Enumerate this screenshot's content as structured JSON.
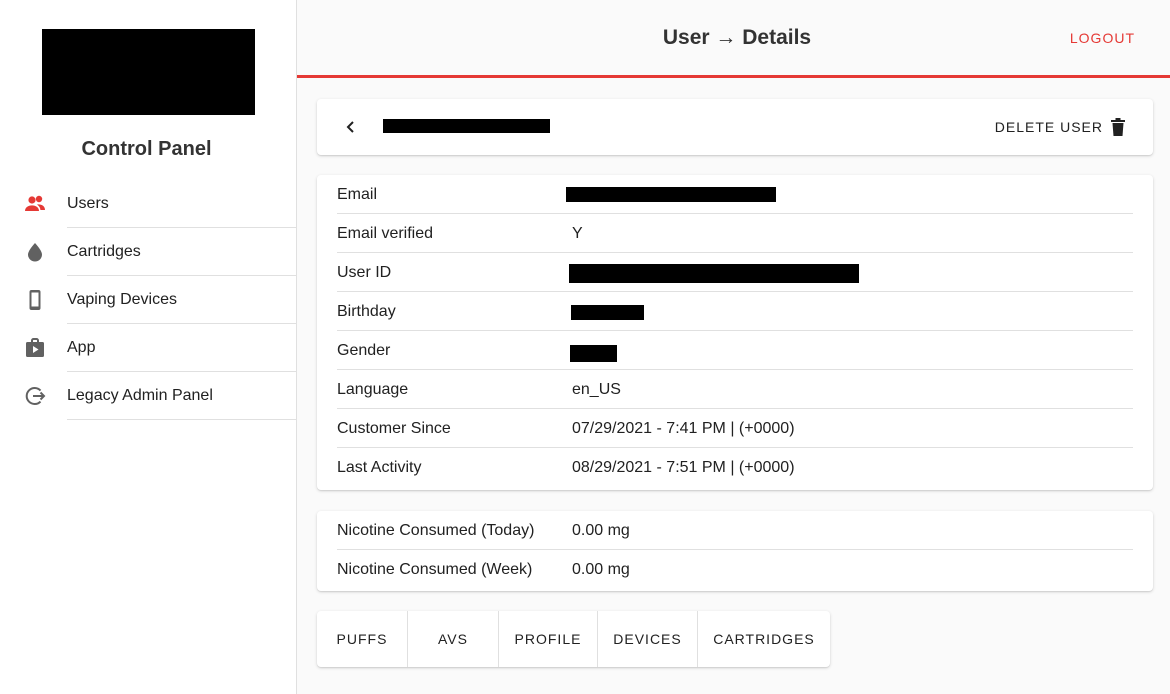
{
  "sidebar": {
    "title": "Control Panel",
    "items": [
      {
        "label": "Users",
        "icon": "users-icon"
      },
      {
        "label": "Cartridges",
        "icon": "drop-icon"
      },
      {
        "label": "Vaping Devices",
        "icon": "phone-icon"
      },
      {
        "label": "App",
        "icon": "store-bag-icon"
      },
      {
        "label": "Legacy Admin Panel",
        "icon": "logout-circle-icon"
      }
    ]
  },
  "header": {
    "title": "User → Details",
    "logout_label": "LOGOUT"
  },
  "toolbar": {
    "delete_label": "DELETE USER"
  },
  "details": [
    {
      "label": "Email",
      "value": ""
    },
    {
      "label": "Email verified",
      "value": "Y"
    },
    {
      "label": "User ID",
      "value": ""
    },
    {
      "label": "Birthday",
      "value": ""
    },
    {
      "label": "Gender",
      "value": ""
    },
    {
      "label": "Language",
      "value": "en_US"
    },
    {
      "label": "Customer Since",
      "value": "07/29/2021 - 7:41 PM | (+0000)"
    },
    {
      "label": "Last Activity",
      "value": "08/29/2021 - 7:51 PM | (+0000)"
    }
  ],
  "nicotine": [
    {
      "label": "Nicotine Consumed (Today)",
      "value": "0.00 mg"
    },
    {
      "label": "Nicotine Consumed (Week)",
      "value": "0.00 mg"
    }
  ],
  "tabs": [
    "PUFFS",
    "AVS",
    "PROFILE",
    "DEVICES",
    "CARTRIDGES"
  ],
  "colors": {
    "accent": "#e53935",
    "icon_gray": "#616161"
  }
}
